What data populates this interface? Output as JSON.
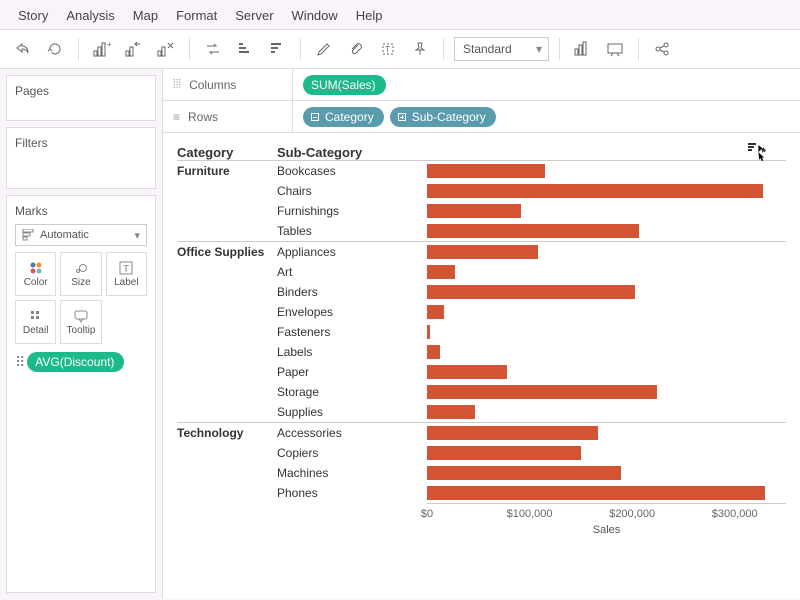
{
  "menu": {
    "items": [
      "Story",
      "Analysis",
      "Map",
      "Format",
      "Server",
      "Window",
      "Help"
    ]
  },
  "toolbar": {
    "fit_mode": "Standard"
  },
  "panels": {
    "pages": "Pages",
    "filters": "Filters",
    "marks": "Marks",
    "marks_type": "Automatic",
    "cards": [
      "Color",
      "Size",
      "Label",
      "Detail",
      "Tooltip"
    ],
    "avg_pill": "AVG(Discount)"
  },
  "shelves": {
    "columns_label": "Columns",
    "rows_label": "Rows",
    "columns_pill": "SUM(Sales)",
    "rows_pills": [
      "Category",
      "Sub-Category"
    ]
  },
  "viz": {
    "header_category": "Category",
    "header_subcategory": "Sub-Category",
    "axis_label": "Sales",
    "axis_ticks": [
      "$0",
      "$100,000",
      "$200,000",
      "$300,000"
    ]
  },
  "chart_data": {
    "type": "bar",
    "xlabel": "Sales",
    "xlim": [
      0,
      350000
    ],
    "groups": [
      {
        "category": "Furniture",
        "rows": [
          {
            "sub": "Bookcases",
            "value": 115000
          },
          {
            "sub": "Chairs",
            "value": 328000
          },
          {
            "sub": "Furnishings",
            "value": 92000
          },
          {
            "sub": "Tables",
            "value": 207000
          }
        ]
      },
      {
        "category": "Office Supplies",
        "rows": [
          {
            "sub": "Appliances",
            "value": 108000
          },
          {
            "sub": "Art",
            "value": 27000
          },
          {
            "sub": "Binders",
            "value": 203000
          },
          {
            "sub": "Envelopes",
            "value": 16500
          },
          {
            "sub": "Fasteners",
            "value": 3000
          },
          {
            "sub": "Labels",
            "value": 12500
          },
          {
            "sub": "Paper",
            "value": 78000
          },
          {
            "sub": "Storage",
            "value": 224000
          },
          {
            "sub": "Supplies",
            "value": 47000
          }
        ]
      },
      {
        "category": "Technology",
        "rows": [
          {
            "sub": "Accessories",
            "value": 167000
          },
          {
            "sub": "Copiers",
            "value": 150000
          },
          {
            "sub": "Machines",
            "value": 189000
          },
          {
            "sub": "Phones",
            "value": 330000
          }
        ]
      }
    ]
  }
}
